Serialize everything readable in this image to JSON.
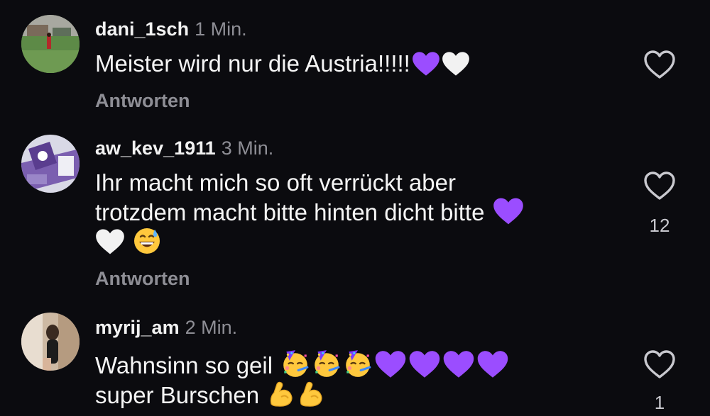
{
  "comments": [
    {
      "username": "dani_1sch",
      "time": "1 Min.",
      "text": "Meister wird nur die Austria!!!!!",
      "emojis": [
        "purple-heart",
        "white-heart"
      ],
      "reply_label": "Antworten",
      "like_count": ""
    },
    {
      "username": "aw_kev_1911",
      "time": "3 Min.",
      "text_line1": "Ihr macht mich so oft verrückt aber",
      "text_line2": "trotzdem macht bitte hinten dicht bitte",
      "emojis_line2": [
        "purple-heart"
      ],
      "emojis_line3": [
        "white-heart",
        "grinning-sweat-face"
      ],
      "reply_label": "Antworten",
      "like_count": "12"
    },
    {
      "username": "myrij_am",
      "time": "2 Min.",
      "text_line1": "Wahnsinn so geil",
      "emojis_line1": [
        "partying-face",
        "partying-face",
        "partying-face",
        "purple-heart",
        "purple-heart",
        "purple-heart",
        "purple-heart"
      ],
      "text_line2": "super Burschen",
      "emojis_line2": [
        "flexed-biceps",
        "flexed-biceps"
      ],
      "like_count": "1"
    }
  ],
  "colors": {
    "background": "#0b0b0f",
    "secondary_text": "#8e8e95",
    "purple_heart": "#9b4dff"
  },
  "icons": {
    "like": "heart-outline-icon"
  }
}
